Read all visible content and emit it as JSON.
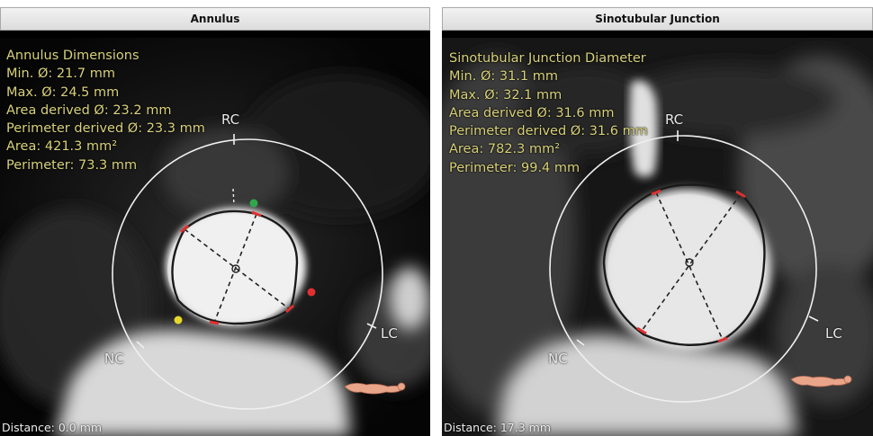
{
  "panels": [
    {
      "title": "Annulus",
      "measure_title": "Annulus Dimensions",
      "min": "Min. Ø: 21.7 mm",
      "max": "Max. Ø: 24.5 mm",
      "area_derived": "Area derived Ø: 23.2 mm",
      "perimeter_derived": "Perimeter derived Ø: 23.3 mm",
      "area": "Area: 421.3 mm²",
      "perimeter": "Perimeter: 73.3 mm",
      "cusp_rc": "RC",
      "cusp_lc": "LC",
      "cusp_nc": "NC",
      "distance": "Distance: 0.0 mm"
    },
    {
      "title": "Sinotubular Junction",
      "measure_title": "Sinotubular Junction Diameter",
      "min": "Min. Ø: 31.1 mm",
      "max": "Max. Ø: 32.1 mm",
      "area_derived": "Area derived Ø: 31.6 mm",
      "perimeter_derived": "Perimeter derived Ø: 31.6 mm",
      "area": "Area: 782.3 mm²",
      "perimeter": "Perimeter: 99.4 mm",
      "cusp_rc": "RC",
      "cusp_lc": "LC",
      "cusp_nc": "NC",
      "distance": "Distance: 17.3 mm"
    }
  ],
  "colors": {
    "measure_text": "#d9d27a",
    "marker_red": "#e03030",
    "marker_green": "#2fa84a",
    "marker_yellow": "#e6d72a"
  }
}
